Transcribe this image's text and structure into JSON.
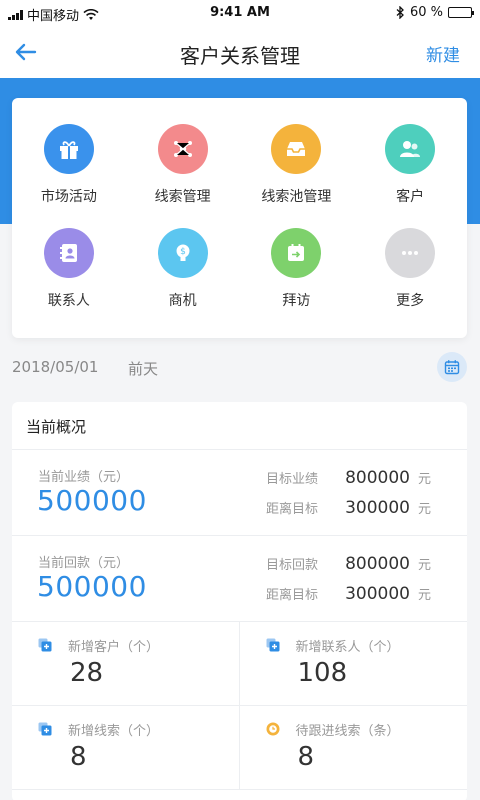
{
  "status_bar": {
    "carrier": "中国移动",
    "time": "9:41 AM",
    "battery": "60 %",
    "battery_level": 0.6
  },
  "nav": {
    "title": "客户关系管理",
    "new_label": "新建"
  },
  "menu": {
    "items": [
      {
        "label": "市场活动",
        "icon": "gift-icon",
        "color": "#3a92ec"
      },
      {
        "label": "线索管理",
        "icon": "network-icon",
        "color": "#f38a8c"
      },
      {
        "label": "线索池管理",
        "icon": "inbox-tray-icon",
        "color": "#f4b33c"
      },
      {
        "label": "客户",
        "icon": "customers-icon",
        "color": "#4ecfbd"
      },
      {
        "label": "联系人",
        "icon": "contact-book-icon",
        "color": "#9a8ce8"
      },
      {
        "label": "商机",
        "icon": "lightbulb-money-icon",
        "color": "#5cc6f0"
      },
      {
        "label": "拜访",
        "icon": "calendar-arrow-icon",
        "color": "#7ed16c"
      },
      {
        "label": "更多",
        "icon": "more-dots-icon",
        "color": "#d9d9dc"
      }
    ]
  },
  "date_filter": {
    "date": "2018/05/01",
    "relative": "前天"
  },
  "overview": {
    "title": "当前概况",
    "performance": {
      "caption": "当前业绩（元）",
      "value": "500000",
      "target_label": "目标业绩",
      "target_value": "800000",
      "gap_label": "距离目标",
      "gap_value": "300000",
      "unit": "元"
    },
    "collection": {
      "caption": "当前回款（元）",
      "value": "500000",
      "target_label": "目标回款",
      "target_value": "800000",
      "gap_label": "距离目标",
      "gap_value": "300000",
      "unit": "元"
    },
    "stats": [
      {
        "label": "新增客户（个）",
        "value": "28",
        "icon": "add-square-icon"
      },
      {
        "label": "新增联系人（个）",
        "value": "108",
        "icon": "add-square-icon"
      },
      {
        "label": "新增线索（个）",
        "value": "8",
        "icon": "add-square-icon"
      },
      {
        "label": "待跟进线索（条）",
        "value": "8",
        "icon": "pending-clock-icon"
      }
    ]
  },
  "colors": {
    "accent": "#2f8de4",
    "pending": "#f4b33c"
  }
}
